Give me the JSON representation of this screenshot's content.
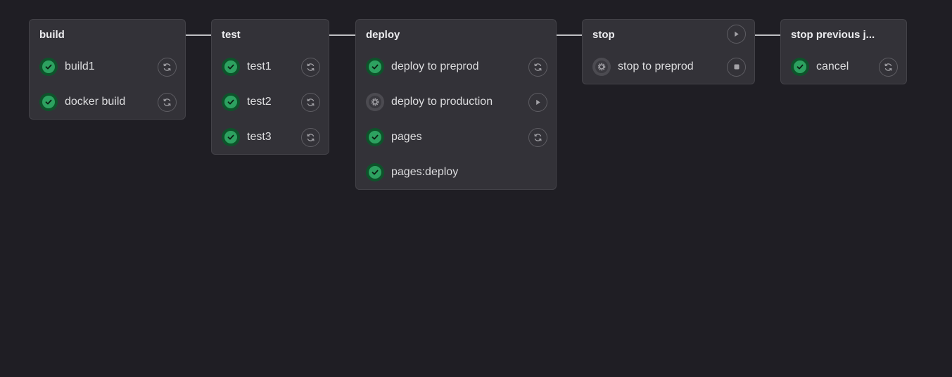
{
  "stages": [
    {
      "title": "build",
      "jobs": [
        {
          "name": "build1",
          "status": "success",
          "action": "retry-icon"
        },
        {
          "name": "docker build",
          "status": "success",
          "action": "retry-icon"
        }
      ]
    },
    {
      "title": "test",
      "jobs": [
        {
          "name": "test1",
          "status": "success",
          "action": "retry-icon"
        },
        {
          "name": "test2",
          "status": "success",
          "action": "retry-icon"
        },
        {
          "name": "test3",
          "status": "success",
          "action": "retry-icon"
        }
      ]
    },
    {
      "title": "deploy",
      "jobs": [
        {
          "name": "deploy to preprod",
          "status": "success",
          "action": "retry-icon"
        },
        {
          "name": "deploy to production",
          "status": "manual",
          "action": "play-icon"
        },
        {
          "name": "pages",
          "status": "success",
          "action": "retry-icon"
        },
        {
          "name": "pages:deploy",
          "status": "success",
          "action": ""
        }
      ]
    },
    {
      "title": "stop",
      "header_action": "play-icon",
      "jobs": [
        {
          "name": "stop to preprod",
          "status": "manual",
          "action": "stop-icon"
        }
      ]
    },
    {
      "title": "stop previous j...",
      "jobs": [
        {
          "name": "cancel",
          "status": "success",
          "action": "retry-icon"
        }
      ]
    }
  ],
  "colors": {
    "background": "#1f1e24",
    "card": "#333238",
    "success": "#2da160",
    "success_ring": "#0d532a",
    "manual": "#4c4b51"
  }
}
